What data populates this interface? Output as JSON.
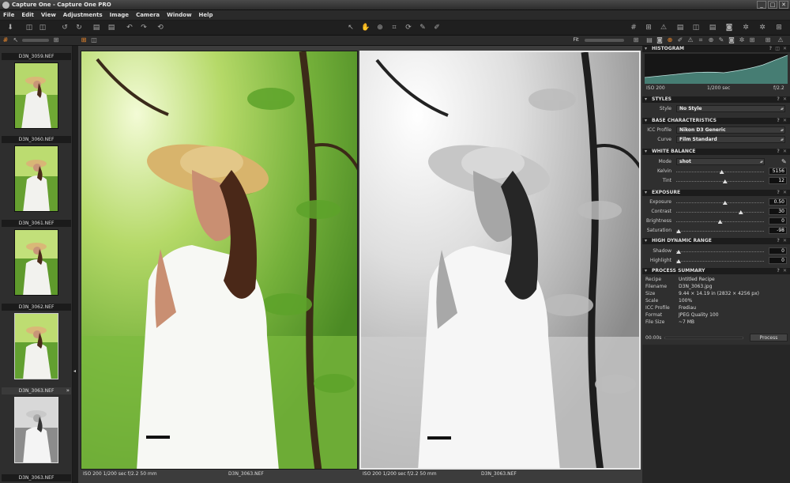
{
  "window": {
    "title": "Capture One - Capture One PRO",
    "minimize": "_",
    "maximize": "□",
    "close": "✕"
  },
  "menu": [
    "File",
    "Edit",
    "View",
    "Adjustments",
    "Image",
    "Camera",
    "Window",
    "Help"
  ],
  "toolbar": {
    "left_icons": [
      "import-icon",
      "capture-icon",
      "compare-icon",
      "rotate-left-icon",
      "rotate-right-icon",
      "folder-icon",
      "trash-icon",
      "undo-icon",
      "redo-icon",
      "reset-icon"
    ],
    "center_icons": [
      "select-cursor-icon",
      "hand-pan-icon",
      "zoom-icon",
      "crop-icon",
      "straighten-icon",
      "rotate-tool-icon",
      "picker-icon",
      "annotate-icon"
    ],
    "right_icons": [
      "grid-icon",
      "guides-icon",
      "warning-icon",
      "exposure-warning-icon",
      "folder-open-icon",
      "stack-icon",
      "export-icon",
      "batch-icon",
      "camera-icon",
      "settings-icon",
      "preferences-icon"
    ],
    "glyphs": {
      "import": "⬇",
      "capture": "◫",
      "rotate_left": "↺",
      "rotate_right": "↻",
      "folder": "▤",
      "trash": "🗑",
      "undo": "↶",
      "redo": "↷",
      "reset": "⟲",
      "cursor": "↖",
      "hand": "✋",
      "zoom": "⊕",
      "crop": "⌗",
      "straighten": "⊾",
      "rotate": "⟳",
      "picker": "✎",
      "annotate": "✐",
      "grid": "#",
      "guides": "⊞",
      "warning": "⚠",
      "camera": "◙",
      "gear": "✲"
    }
  },
  "viewer_bar": {
    "fit_label": "Fit"
  },
  "browser": {
    "thumbnails": [
      {
        "name": "D3N_3059.NEF",
        "style": "color",
        "selected": false
      },
      {
        "name": "D3N_3060.NEF",
        "style": "color",
        "selected": false
      },
      {
        "name": "D3N_3061.NEF",
        "style": "color",
        "selected": false
      },
      {
        "name": "D3N_3062.NEF",
        "style": "color",
        "selected": true
      },
      {
        "name": "D3N_3063.NEF",
        "style": "bw",
        "selected": true
      }
    ],
    "bottom_label": "D3N_3063.NEF"
  },
  "viewer": {
    "left": {
      "info": "ISO 200   1/200 sec   f/2.2   50 mm",
      "filename": "D3N_3063.NEF"
    },
    "right": {
      "info": "ISO 200   1/200 sec   f/2.2   50 mm",
      "filename": "D3N_3063.NEF"
    }
  },
  "inspector": {
    "tabs_icons": [
      "library-icon",
      "capture-tab-icon",
      "color-icon",
      "exposure-tab-icon",
      "lens-icon",
      "crop-tab-icon",
      "details-icon",
      "adjustments-icon",
      "metadata-icon",
      "output-icon",
      "batch-tab-icon"
    ],
    "histogram": {
      "title": "HISTOGRAM",
      "iso": "ISO 200",
      "shutter": "1/200 sec",
      "aperture": "f/2.2"
    },
    "styles": {
      "title": "STYLES",
      "style_label": "Style",
      "style_value": "No Style"
    },
    "base": {
      "title": "BASE CHARACTERISTICS",
      "icc_label": "ICC Profile",
      "icc_value": "Nikon D3 Generic",
      "curve_label": "Curve",
      "curve_value": "Film Standard"
    },
    "white_balance": {
      "title": "WHITE BALANCE",
      "mode_label": "Mode",
      "mode_value": "shot",
      "kelvin_label": "Kelvin",
      "kelvin_value": "5156",
      "kelvin_pos": 0.52,
      "tint_label": "Tint",
      "tint_value": "12",
      "tint_pos": 0.56
    },
    "exposure": {
      "title": "EXPOSURE",
      "exposure_label": "Exposure",
      "exposure_value": "0.50",
      "exposure_pos": 0.56,
      "contrast_label": "Contrast",
      "contrast_value": "30",
      "contrast_pos": 0.75,
      "brightness_label": "Brightness",
      "brightness_value": "0",
      "brightness_pos": 0.5,
      "saturation_label": "Saturation",
      "saturation_value": "-98",
      "saturation_pos": 0.0
    },
    "hdr": {
      "title": "HIGH DYNAMIC RANGE",
      "shadow_label": "Shadow",
      "shadow_value": "0",
      "shadow_pos": 0.0,
      "highlight_label": "Highlight",
      "highlight_value": "0",
      "highlight_pos": 0.0
    },
    "summary": {
      "title": "PROCESS SUMMARY",
      "rows": [
        {
          "k": "Recipe",
          "v": "Untitled Recipe"
        },
        {
          "k": "Filename",
          "v": "D3N_3063.jpg"
        },
        {
          "k": "Size",
          "v": "9.44  ×  14.19  in  (2832 × 4256  px)"
        },
        {
          "k": "Scale",
          "v": "100%"
        },
        {
          "k": "ICC Profile",
          "v": "Frediau"
        },
        {
          "k": "Format",
          "v": "JPEG Quality 100"
        },
        {
          "k": "File Size",
          "v": "~7 MB"
        }
      ],
      "time": "00:00s",
      "process_button": "Process"
    }
  }
}
